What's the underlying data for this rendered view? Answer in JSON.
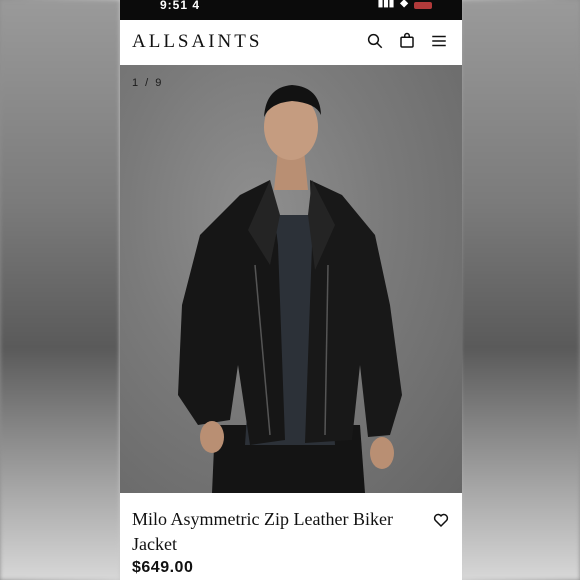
{
  "status_bar": {
    "time": "9:51 4"
  },
  "header": {
    "brand": "ALLSAINTS"
  },
  "gallery": {
    "indicator": "1 / 9"
  },
  "product": {
    "title": "Milo Asymmetric Zip Leather Biker Jacket",
    "price": "$649.00"
  },
  "icons": {
    "search": "search-icon",
    "bag": "bag-icon",
    "menu": "menu-icon",
    "wishlist": "heart-icon"
  }
}
